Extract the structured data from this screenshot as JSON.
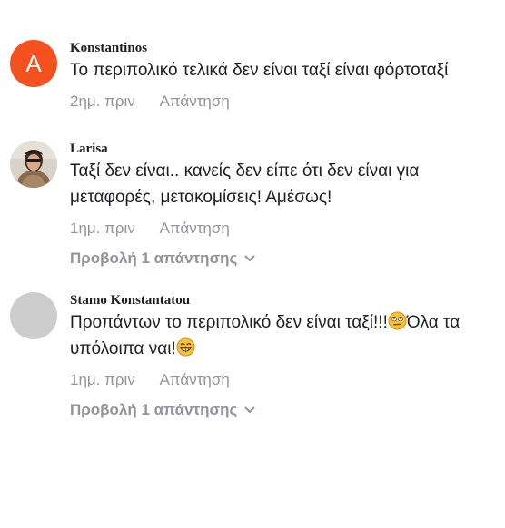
{
  "comments": [
    {
      "author": "Konstantinos",
      "avatar_letter": "A",
      "text": "Το περιπολικό τελικά δεν είναι ταξί είναι φόρτοταξί",
      "time": "2ημ. πριν",
      "reply": "Απάντηση"
    },
    {
      "author": "Larisa",
      "text": "Ταξί δεν είναι.. κανείς δεν είπε ότι δεν είναι για μεταφορές, μετακομίσεις! Αμέσως!",
      "time": "1ημ. πριν",
      "reply": "Απάντηση",
      "replies_link": "Προβολή 1 απάντησης"
    },
    {
      "author": "Stamo Konstantatou",
      "text_part1": "Προπάντων το περιπολικό δεν είναι ταξί!!!",
      "text_part2": "Όλα τα υπόλοιπα ναι!",
      "emoji1": "rolling-eyes-emoji",
      "emoji2": "grinning-emoji",
      "time": "1ημ. πριν",
      "reply": "Απάντηση",
      "replies_link": "Προβολή 1 απάντησης"
    }
  ],
  "colors": {
    "avatar_letter_bg": "#f4511e",
    "avatar_grey_bg": "#cccccc",
    "meta_text": "#90949c",
    "body_text": "#1c1e21"
  }
}
